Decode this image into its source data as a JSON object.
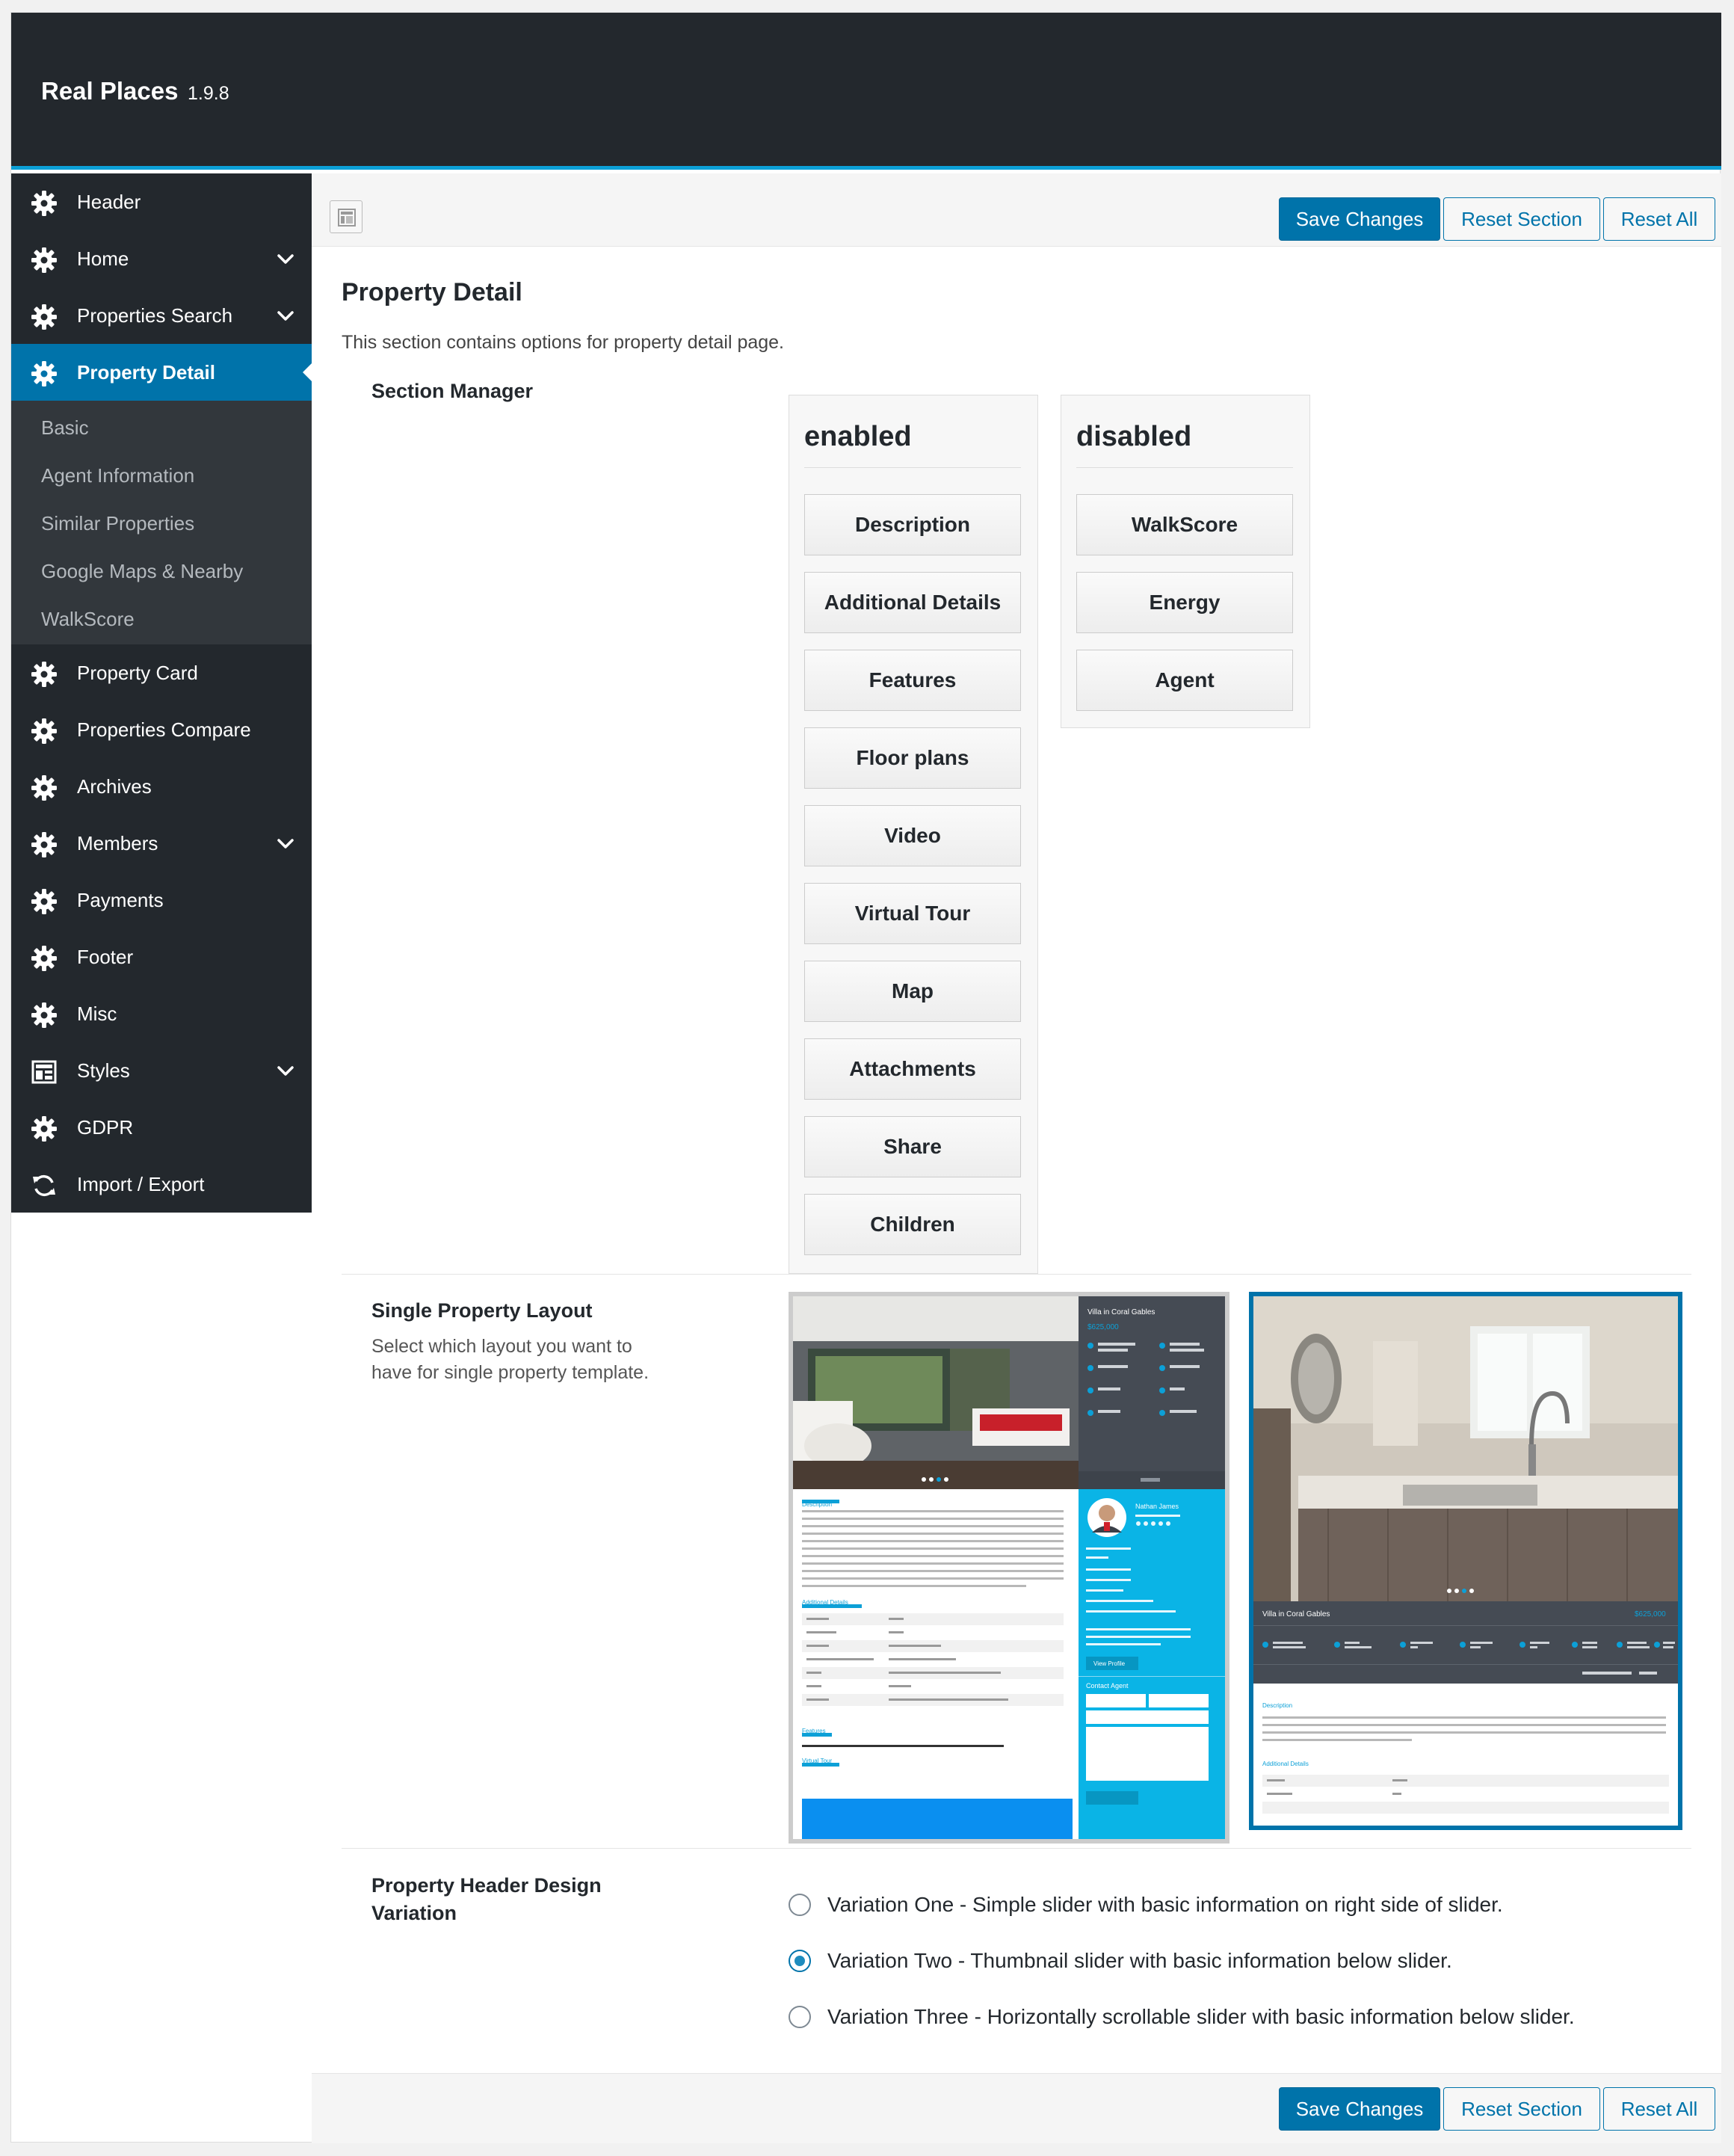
{
  "app": {
    "title": "Real Places",
    "version": "1.9.8"
  },
  "colors": {
    "accent": "#0073aa",
    "sidebar_bg": "#23282d",
    "topbar_border": "#0ca0d7"
  },
  "sidebar": {
    "items": [
      {
        "label": "Header",
        "icon": "gear-icon"
      },
      {
        "label": "Home",
        "icon": "gear-icon",
        "has_children": true
      },
      {
        "label": "Properties Search",
        "icon": "gear-icon",
        "has_children": true
      },
      {
        "label": "Property Detail",
        "icon": "gear-icon",
        "active": true
      },
      {
        "label": "Property Card",
        "icon": "gear-icon"
      },
      {
        "label": "Properties Compare",
        "icon": "gear-icon"
      },
      {
        "label": "Archives",
        "icon": "gear-icon"
      },
      {
        "label": "Members",
        "icon": "gear-icon",
        "has_children": true
      },
      {
        "label": "Payments",
        "icon": "gear-icon"
      },
      {
        "label": "Footer",
        "icon": "gear-icon"
      },
      {
        "label": "Misc",
        "icon": "gear-icon"
      },
      {
        "label": "Styles",
        "icon": "layout-icon",
        "has_children": true
      },
      {
        "label": "GDPR",
        "icon": "gear-icon"
      },
      {
        "label": "Import / Export",
        "icon": "refresh-icon"
      }
    ],
    "submenu": [
      "Basic",
      "Agent Information",
      "Similar Properties",
      "Google Maps & Nearby",
      "WalkScore"
    ]
  },
  "toolbar": {
    "save_label": "Save Changes",
    "reset_section_label": "Reset Section",
    "reset_all_label": "Reset All"
  },
  "main": {
    "title": "Property Detail",
    "description": "This section contains options for property detail page.",
    "section_manager": {
      "label": "Section Manager",
      "enabled_title": "enabled",
      "disabled_title": "disabled",
      "enabled": [
        "Description",
        "Additional Details",
        "Features",
        "Floor plans",
        "Video",
        "Virtual Tour",
        "Map",
        "Attachments",
        "Share",
        "Children"
      ],
      "disabled": [
        "WalkScore",
        "Energy",
        "Agent"
      ]
    },
    "layout": {
      "label": "Single Property Layout",
      "description_line1": "Select which layout you want to",
      "description_line2": "have for single property template.",
      "selected": 2,
      "preview_one": {
        "title": "Villa in Coral Gables",
        "price": "$625,000",
        "agent": "Nathan James",
        "view_profile": "View Profile",
        "contact": "Contact Agent",
        "description": "Description",
        "additional": "Additional Details",
        "features": "Features",
        "virtual_tour": "Virtual Tour"
      },
      "preview_two": {
        "title": "Villa in Coral Gables",
        "price": "$625,000",
        "description": "Description",
        "additional": "Additional Details"
      }
    },
    "header_design": {
      "label_line1": "Property Header Design",
      "label_line2": "Variation",
      "options": [
        "Variation One - Simple slider with basic information on right side of slider.",
        "Variation Two - Thumbnail slider with basic information below slider.",
        "Variation Three - Horizontally scrollable slider with basic information below slider."
      ],
      "selected": 1
    }
  }
}
